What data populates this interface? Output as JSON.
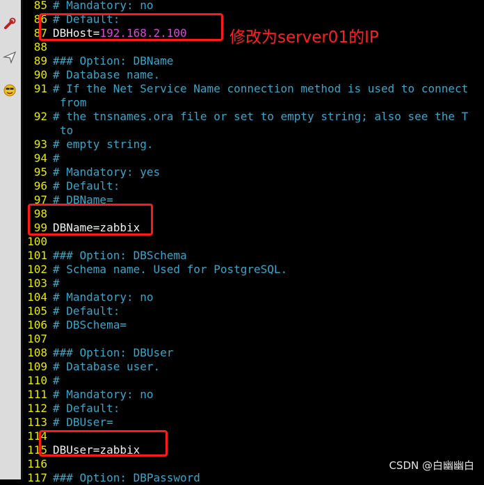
{
  "annotation": "修改为server01的IP",
  "watermark": "CSDN @白幽幽白",
  "sidebar": {
    "icons": [
      "wrench-icon",
      "paper-plane-icon",
      "smiley-icon"
    ]
  },
  "colors": {
    "background": "#000000",
    "line_number": "#e8e800",
    "comment": "#3aa6c8",
    "plain": "#f0f0f0",
    "value": "#d848d8",
    "highlight_box": "#ff1a1a"
  },
  "lines": [
    {
      "n": "85",
      "segs": [
        {
          "t": "# Mandatory: no",
          "c": "comment"
        }
      ]
    },
    {
      "n": "86",
      "segs": [
        {
          "t": "# Default:",
          "c": "comment"
        }
      ]
    },
    {
      "n": "87",
      "segs": [
        {
          "t": "DBHost=",
          "c": "plain"
        },
        {
          "t": "192.168.2.100",
          "c": "val"
        }
      ]
    },
    {
      "n": "88",
      "segs": []
    },
    {
      "n": "89",
      "segs": [
        {
          "t": "### Option: DBName",
          "c": "comment"
        }
      ]
    },
    {
      "n": "90",
      "segs": [
        {
          "t": "# Database name.",
          "c": "comment"
        }
      ]
    },
    {
      "n": "91",
      "segs": [
        {
          "t": "# If the Net Service Name connection method is used to connect",
          "c": "comment"
        }
      ]
    },
    {
      "n": "",
      "wrap": true,
      "segs": [
        {
          "t": "from",
          "c": "comment"
        }
      ]
    },
    {
      "n": "92",
      "segs": [
        {
          "t": "# the tnsnames.ora file or set to empty string; also see the T",
          "c": "comment"
        }
      ]
    },
    {
      "n": "",
      "wrap": true,
      "segs": [
        {
          "t": "to",
          "c": "comment"
        }
      ]
    },
    {
      "n": "93",
      "segs": [
        {
          "t": "# empty string.",
          "c": "comment"
        }
      ]
    },
    {
      "n": "94",
      "segs": [
        {
          "t": "#",
          "c": "comment"
        }
      ]
    },
    {
      "n": "95",
      "segs": [
        {
          "t": "# Mandatory: yes",
          "c": "comment"
        }
      ]
    },
    {
      "n": "96",
      "segs": [
        {
          "t": "# Default:",
          "c": "comment"
        }
      ]
    },
    {
      "n": "97",
      "segs": [
        {
          "t": "# DBName=",
          "c": "comment"
        }
      ]
    },
    {
      "n": "98",
      "segs": []
    },
    {
      "n": "99",
      "segs": [
        {
          "t": "DBName=zabbix",
          "c": "plain"
        }
      ]
    },
    {
      "n": "100",
      "segs": []
    },
    {
      "n": "101",
      "segs": [
        {
          "t": "### Option: DBSchema",
          "c": "comment"
        }
      ]
    },
    {
      "n": "102",
      "segs": [
        {
          "t": "# Schema name. Used for PostgreSQL.",
          "c": "comment"
        }
      ]
    },
    {
      "n": "103",
      "segs": [
        {
          "t": "#",
          "c": "comment"
        }
      ]
    },
    {
      "n": "104",
      "segs": [
        {
          "t": "# Mandatory: no",
          "c": "comment"
        }
      ]
    },
    {
      "n": "105",
      "segs": [
        {
          "t": "# Default:",
          "c": "comment"
        }
      ]
    },
    {
      "n": "106",
      "segs": [
        {
          "t": "# DBSchema=",
          "c": "comment"
        }
      ]
    },
    {
      "n": "107",
      "segs": []
    },
    {
      "n": "108",
      "segs": [
        {
          "t": "### Option: DBUser",
          "c": "comment"
        }
      ]
    },
    {
      "n": "109",
      "segs": [
        {
          "t": "# Database user.",
          "c": "comment"
        }
      ]
    },
    {
      "n": "110",
      "segs": [
        {
          "t": "#",
          "c": "comment"
        }
      ]
    },
    {
      "n": "111",
      "segs": [
        {
          "t": "# Mandatory: no",
          "c": "comment"
        }
      ]
    },
    {
      "n": "112",
      "segs": [
        {
          "t": "# Default:",
          "c": "comment"
        }
      ]
    },
    {
      "n": "113",
      "segs": [
        {
          "t": "# DBUser=",
          "c": "comment"
        }
      ]
    },
    {
      "n": "114",
      "segs": []
    },
    {
      "n": "115",
      "segs": [
        {
          "t": "DBUser=zabbix",
          "c": "plain"
        }
      ]
    },
    {
      "n": "116",
      "segs": []
    },
    {
      "n": "117",
      "segs": [
        {
          "t": "### Option: DBPassword",
          "c": "comment"
        }
      ]
    }
  ]
}
